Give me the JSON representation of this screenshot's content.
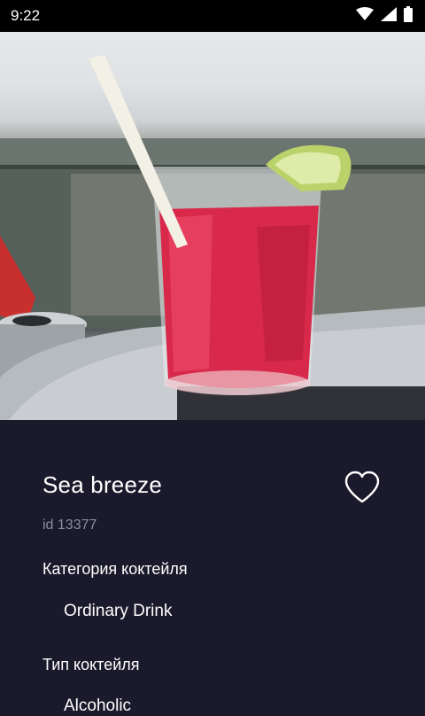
{
  "status_bar": {
    "time": "9:22",
    "icons": [
      "wifi-icon",
      "cell-signal-icon",
      "battery-icon"
    ]
  },
  "hero_image": {
    "subject": "red cocktail glass with ice, straw and lime wedge"
  },
  "drink": {
    "name": "Sea breeze",
    "id_text": "id 13377",
    "favorite_icon": "heart-outline-icon",
    "category_label": "Категория коктейля",
    "category_value": "Ordinary Drink",
    "type_label": "Тип коктейля",
    "type_value": "Alcoholic"
  },
  "colors": {
    "background": "#1b1a2c",
    "text": "#ffffff",
    "muted": "#8e8e9c"
  }
}
